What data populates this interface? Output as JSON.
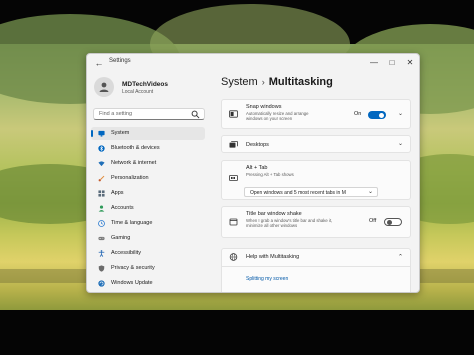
{
  "window": {
    "title": "Settings",
    "minimize_glyph": "—",
    "maximize_glyph": "□",
    "close_glyph": "✕"
  },
  "user": {
    "name": "MDTechVideos",
    "account": "Local Account"
  },
  "search": {
    "placeholder": "Find a setting"
  },
  "sidebar": {
    "items": [
      {
        "label": "System",
        "icon": "monitor-icon",
        "selected": true,
        "color": "#0067c0"
      },
      {
        "label": "Bluetooth & devices",
        "icon": "bluetooth-icon",
        "color": "#0067c0"
      },
      {
        "label": "Network & internet",
        "icon": "wifi-icon",
        "color": "#1f6fb8"
      },
      {
        "label": "Personalization",
        "icon": "brush-icon",
        "color": "#e08b3a"
      },
      {
        "label": "Apps",
        "icon": "apps-icon",
        "color": "#5a6b7b"
      },
      {
        "label": "Accounts",
        "icon": "person-icon",
        "color": "#2f9a5a"
      },
      {
        "label": "Time & language",
        "icon": "globe-clock-icon",
        "color": "#2b7bd0"
      },
      {
        "label": "Gaming",
        "icon": "controller-icon",
        "color": "#7a7a7a"
      },
      {
        "label": "Accessibility",
        "icon": "accessibility-icon",
        "color": "#2467b4"
      },
      {
        "label": "Privacy & security",
        "icon": "shield-icon",
        "color": "#6b6b6b"
      },
      {
        "label": "Windows Update",
        "icon": "update-icon",
        "color": "#1f6fb8"
      }
    ]
  },
  "breadcrumb": {
    "parent": "System",
    "separator": "›",
    "current": "Multitasking"
  },
  "snap": {
    "title": "Snap windows",
    "description": "Automatically resize and arrange windows on your screen",
    "state_label": "On",
    "on": true
  },
  "desktops": {
    "title": "Desktops"
  },
  "alttab": {
    "title": "Alt + Tab",
    "description": "Pressing Alt + Tab shows",
    "selected": "Open windows and 5 most recent tabs in M"
  },
  "shake": {
    "title": "Title bar window shake",
    "description": "When I grab a window's title bar and shake it, minimize all other windows",
    "state_label": "Off",
    "on": false
  },
  "help": {
    "title": "Help with Multitasking",
    "link": "Splitting my screen"
  },
  "colors": {
    "accent": "#0067c0",
    "link": "#0058a8"
  }
}
